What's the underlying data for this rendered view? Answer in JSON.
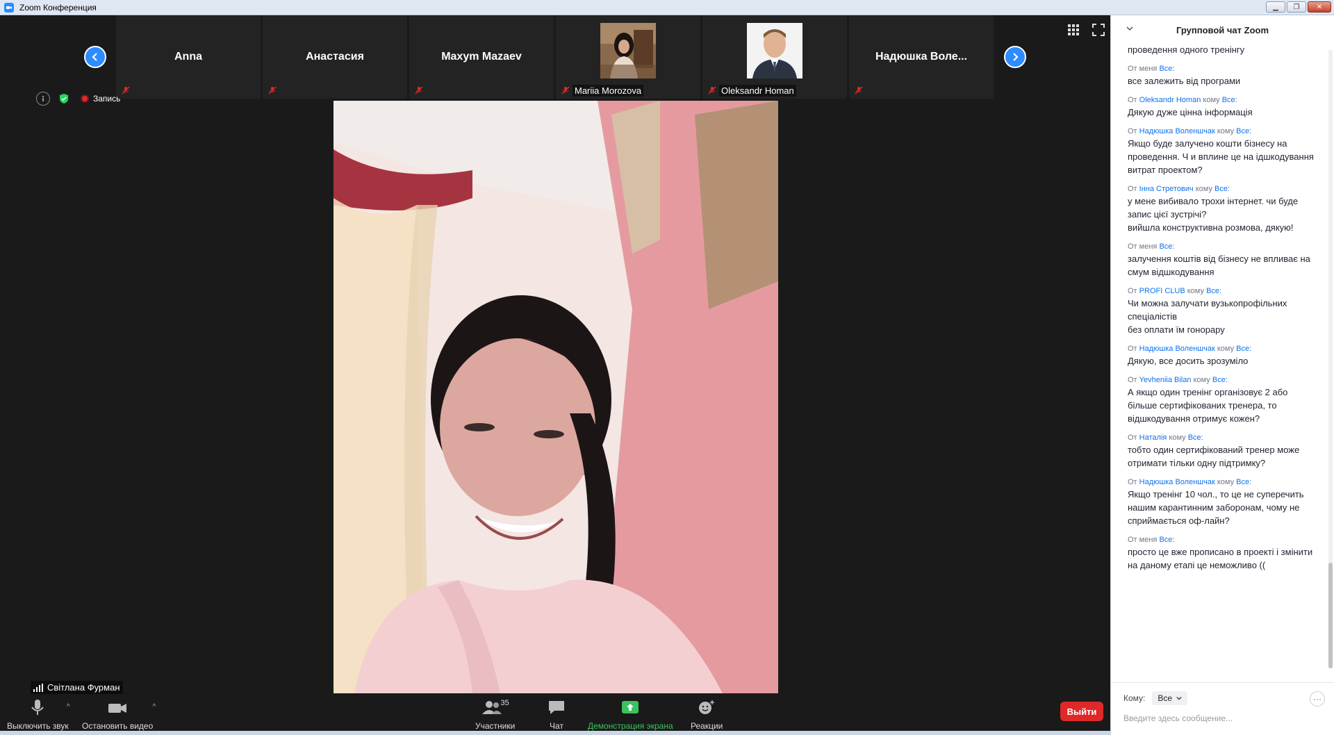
{
  "window": {
    "title": "Zoom Конференция"
  },
  "strip": {
    "tiles": [
      {
        "name": "Anna"
      },
      {
        "name": "Анастасия"
      },
      {
        "name": "Maxym Mazaev"
      },
      {
        "label": "Mariia Morozova"
      },
      {
        "label": "Oleksandr Homan"
      },
      {
        "name": "Надюшка  Воле..."
      }
    ]
  },
  "indicators": {
    "record_label": "Запись"
  },
  "speaker": {
    "name": "Світлана Фурман"
  },
  "toolbar": {
    "mute_label": "Выключить звук",
    "video_label": "Остановить видео",
    "participants_label": "Участники",
    "participants_count": "35",
    "chat_label": "Чат",
    "share_label": "Демонстрация экрана",
    "reactions_label": "Реакции",
    "leave_label": "Выйти"
  },
  "chat": {
    "title": "Групповой чат Zoom",
    "messages": [
      {
        "text": "проведення одного тренінгу"
      },
      {
        "prefix": "От",
        "from": "меня",
        "to_word": "",
        "to": "Все:",
        "text": "все залежить від програми"
      },
      {
        "prefix": "От",
        "from": "Oleksandr Homan",
        "to_word": "кому",
        "to": "Все:",
        "text": "Дякую дуже цінна інформація"
      },
      {
        "prefix": "От",
        "from": "Надюшка Воленшчак",
        "to_word": "кому",
        "to": "Все:",
        "text": "Якщо буде залучено кошти бізнесу на проведення. Ч и вплине це на ідшкодування витрат проектом?"
      },
      {
        "prefix": "От",
        "from": "Інна Стретович",
        "to_word": "кому",
        "to": "Все:",
        "text": "у мене вибивало трохи інтернет. чи буде запис цієї зустрічі?\nвийшла конструктивна розмова, дякую!"
      },
      {
        "prefix": "От",
        "from": "меня",
        "to_word": "",
        "to": "Все:",
        "text": "залучення коштів від бізнесу не впливає на смум відшкодування"
      },
      {
        "prefix": "От",
        "from": "PROFI CLUB",
        "to_word": "кому",
        "to": "Все:",
        "text": "Чи можна залучати вузькопрофільних спеціалістів\nбез оплати їм гонорару"
      },
      {
        "prefix": "От",
        "from": "Надюшка Воленшчак",
        "to_word": "кому",
        "to": "Все:",
        "text": "Дякую, все досить зрозуміло"
      },
      {
        "prefix": "От",
        "from": "Yevheniia Bilan",
        "to_word": "кому",
        "to": "Все:",
        "text": "А якщо один тренінг організовує 2 або більше сертифікованих тренера, то відшкодування отримує кожен?"
      },
      {
        "prefix": "От",
        "from": "Наталія",
        "to_word": "кому",
        "to": "Все:",
        "text": "тобто один сертифікований тренер може отримати тільки одну підтримку?"
      },
      {
        "prefix": "От",
        "from": "Надюшка Воленшчак",
        "to_word": "кому",
        "to": "Все:",
        "text": "Якщо тренінг 10 чол., то це не суперечить нашим карантинним заборонам, чому не сприймається оф-лайн?"
      },
      {
        "prefix": "От",
        "from": "меня",
        "to_word": "",
        "to": "Все:",
        "text": "просто це вже прописано в проекті і змінити на даному етапі це неможливо (("
      }
    ],
    "to_label": "Кому:",
    "to_value": "Все",
    "input_placeholder": "Введите здесь сообщение..."
  },
  "colors": {
    "accent": "#2d8cff",
    "leave": "#e02828",
    "share_green": "#3ac35c",
    "chat_name": "#0e71eb"
  }
}
